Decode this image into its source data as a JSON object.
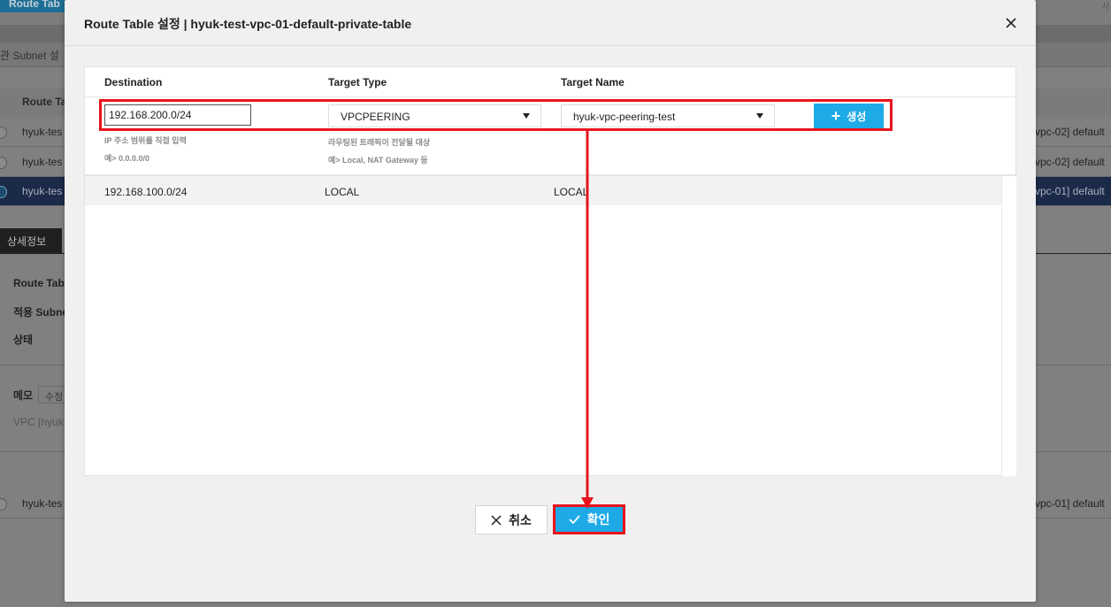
{
  "background": {
    "title_tab": "Route Tab",
    "right_text": "사",
    "subnet_label": "관 Subnet 설",
    "header_col": "Route Ta",
    "rows": [
      {
        "left": "hyuk-tes",
        "right": "vpc-02] default"
      },
      {
        "left": "hyuk-tes",
        "right": "vpc-02] default"
      },
      {
        "left": "hyuk-tes",
        "right": "vpc-01] default"
      }
    ],
    "detail_tab": "상세정보",
    "labels": [
      "Route Tab",
      "적용 Subne",
      "상태"
    ],
    "memo_label": "메모",
    "memo_button": "수정",
    "vpc_text": "VPC [hyuk",
    "bottom_row": {
      "left": "hyuk-tes",
      "right": "vpc-01] default"
    }
  },
  "modal": {
    "title": "Route Table 설정 | hyuk-test-vpc-01-default-private-table",
    "columns": {
      "destination": "Destination",
      "target_type": "Target Type",
      "target_name": "Target Name"
    },
    "form": {
      "destination_value": "192.168.200.0/24",
      "destination_hint_1": "IP 주소 범위를 직접 입력",
      "destination_hint_2": "예> 0.0.0.0/0",
      "target_type_value": "VPCPEERING",
      "target_type_hint_1": "라우팅된 트래픽이 전달될 대상",
      "target_type_hint_2": "예> Local, NAT Gateway 등",
      "target_name_value": "hyuk-vpc-peering-test",
      "add_label": "생성"
    },
    "routes": [
      {
        "destination": "192.168.100.0/24",
        "target_type": "LOCAL",
        "target_name": "LOCAL"
      }
    ],
    "cancel_label": "취소",
    "confirm_label": "확인"
  },
  "colors": {
    "accent": "#1eaae7",
    "highlight": "#e8141b"
  }
}
